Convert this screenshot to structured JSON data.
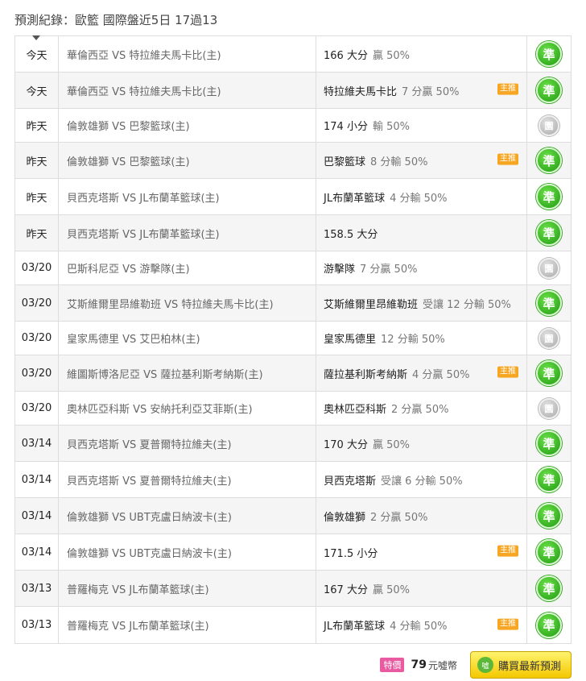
{
  "header": {
    "title": "預測紀錄：歐籃 國際盤近5日 17過13"
  },
  "rows": [
    {
      "date": "今天",
      "match": "華倫西亞 VS 特拉維夫馬卡比(主)",
      "pick": "166 大分",
      "odds": "贏 50%",
      "tag": "",
      "result": "準",
      "type": "win",
      "h": 45
    },
    {
      "date": "今天",
      "match": "華倫西亞 VS 特拉維夫馬卡比(主)",
      "pick": "特拉維夫馬卡比",
      "odds": "7 分贏 50%",
      "tag": "主推",
      "result": "準",
      "type": "win",
      "h": 45
    },
    {
      "date": "昨天",
      "match": "倫敦雄獅 VS 巴黎籃球(主)",
      "pick": "174 小分",
      "odds": "輸 50%",
      "tag": "",
      "result": "園",
      "type": "push",
      "h": 42
    },
    {
      "date": "昨天",
      "match": "倫敦雄獅 VS 巴黎籃球(主)",
      "pick": "巴黎籃球",
      "odds": "8 分輸 50%",
      "tag": "主推",
      "result": "準",
      "type": "win",
      "h": 45
    },
    {
      "date": "昨天",
      "match": "貝西克塔斯 VS JL布蘭革籃球(主)",
      "pick": "JL布蘭革籃球",
      "odds": "4 分輸 50%",
      "tag": "",
      "result": "準",
      "type": "win",
      "h": 45
    },
    {
      "date": "昨天",
      "match": "貝西克塔斯 VS JL布蘭革籃球(主)",
      "pick": "158.5 大分",
      "odds": "",
      "tag": "",
      "result": "準",
      "type": "win",
      "h": 45
    },
    {
      "date": "03/20",
      "match": "巴斯科尼亞 VS 游擊隊(主)",
      "pick": "游擊隊",
      "odds": "7 分贏 50%",
      "tag": "",
      "result": "園",
      "type": "push",
      "h": 42
    },
    {
      "date": "03/20",
      "match": "艾斯維爾里昂維勒班 VS 特拉維夫馬卡比(主)",
      "pick": "艾斯維爾里昂維勒班",
      "odds": "受讓 12 分輸 50%",
      "tag": "",
      "result": "準",
      "type": "win",
      "h": 45
    },
    {
      "date": "03/20",
      "match": "皇家馬德里 VS 艾巴柏林(主)",
      "pick": "皇家馬德里",
      "odds": "12 分輸 50%",
      "tag": "",
      "result": "園",
      "type": "push",
      "h": 42
    },
    {
      "date": "03/20",
      "match": "維圖斯博洛尼亞 VS 薩拉基利斯考納斯(主)",
      "pick": "薩拉基利斯考納斯",
      "odds": "4 分贏 50%",
      "tag": "主推",
      "result": "準",
      "type": "win",
      "h": 45
    },
    {
      "date": "03/20",
      "match": "奧林匹亞科斯 VS 安納托利亞艾菲斯(主)",
      "pick": "奧林匹亞科斯",
      "odds": "2 分贏 50%",
      "tag": "",
      "result": "園",
      "type": "push",
      "h": 42
    },
    {
      "date": "03/14",
      "match": "貝西克塔斯 VS 夏普爾特拉維夫(主)",
      "pick": "170 大分",
      "odds": "贏 50%",
      "tag": "",
      "result": "準",
      "type": "win",
      "h": 45
    },
    {
      "date": "03/14",
      "match": "貝西克塔斯 VS 夏普爾特拉維夫(主)",
      "pick": "貝西克塔斯",
      "odds": "受讓 6 分輸 50%",
      "tag": "",
      "result": "準",
      "type": "win",
      "h": 45
    },
    {
      "date": "03/14",
      "match": "倫敦雄獅 VS UBT克盧日納波卡(主)",
      "pick": "倫敦雄獅",
      "odds": "2 分贏 50%",
      "tag": "",
      "result": "準",
      "type": "win",
      "h": 45
    },
    {
      "date": "03/14",
      "match": "倫敦雄獅 VS UBT克盧日納波卡(主)",
      "pick": "171.5 小分",
      "odds": "",
      "tag": "主推",
      "result": "準",
      "type": "win",
      "h": 45
    },
    {
      "date": "03/13",
      "match": "普羅梅克 VS JL布蘭革籃球(主)",
      "pick": "167 大分",
      "odds": "贏 50%",
      "tag": "",
      "result": "準",
      "type": "win",
      "h": 45
    },
    {
      "date": "03/13",
      "match": "普羅梅克 VS JL布蘭革籃球(主)",
      "pick": "JL布蘭革籃球",
      "odds": "4 分輸 50%",
      "tag": "主推",
      "result": "準",
      "type": "win",
      "h": 46
    }
  ],
  "footer": {
    "special_label": "特價",
    "price": "79",
    "unit": "元噓幣",
    "buy_icon": "噓",
    "buy_label": "購買最新預測"
  }
}
